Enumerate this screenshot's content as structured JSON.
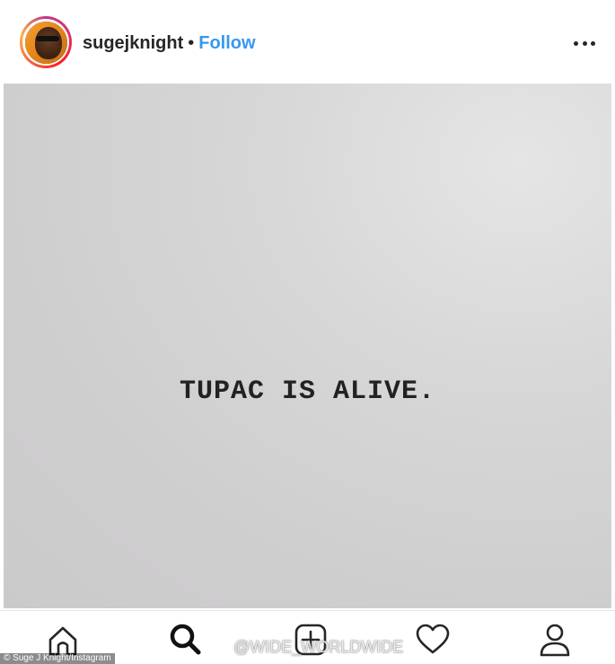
{
  "header": {
    "username": "sugejknight",
    "separator": "•",
    "follow_label": "Follow",
    "more_icon": "more-horizontal-icon"
  },
  "post": {
    "caption": "TUPAC IS ALIVE."
  },
  "nav": {
    "items": [
      {
        "icon": "home-icon"
      },
      {
        "icon": "search-icon"
      },
      {
        "icon": "add-post-icon"
      },
      {
        "icon": "heart-icon"
      },
      {
        "icon": "profile-icon"
      }
    ]
  },
  "overlay": {
    "watermark": "@WIDE_WORLDWIDE",
    "credit": "© Suge J Knight/Instagram"
  },
  "colors": {
    "follow": "#3897f0",
    "text": "#262626",
    "post_bg": "#d3d2d3"
  }
}
